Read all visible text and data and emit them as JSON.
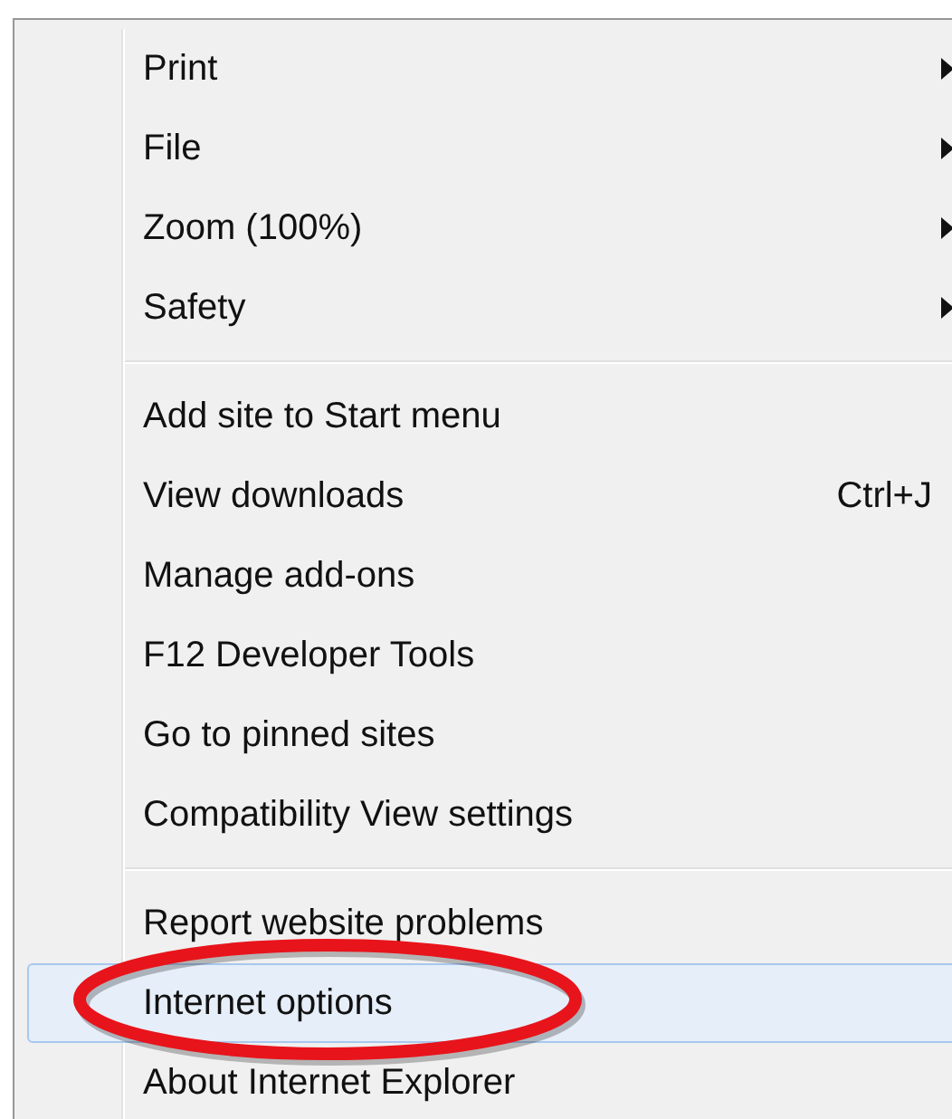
{
  "menu": {
    "groups": [
      {
        "items": [
          {
            "label": "Print",
            "kind": "submenu",
            "selected": false
          },
          {
            "label": "File",
            "kind": "submenu",
            "selected": false
          },
          {
            "label": "Zoom (100%)",
            "kind": "submenu",
            "selected": false
          },
          {
            "label": "Safety",
            "kind": "submenu",
            "selected": false
          }
        ]
      },
      {
        "items": [
          {
            "label": "Add site to Start menu",
            "kind": "plain",
            "selected": false
          },
          {
            "label": "View downloads",
            "kind": "shortcut",
            "shortcut": "Ctrl+J",
            "selected": false
          },
          {
            "label": "Manage add-ons",
            "kind": "plain",
            "selected": false
          },
          {
            "label": "F12 Developer Tools",
            "kind": "plain",
            "selected": false
          },
          {
            "label": "Go to pinned sites",
            "kind": "plain",
            "selected": false
          },
          {
            "label": "Compatibility View settings",
            "kind": "plain",
            "selected": false
          }
        ]
      },
      {
        "items": [
          {
            "label": "Report website problems",
            "kind": "plain",
            "selected": false
          },
          {
            "label": "Internet options",
            "kind": "plain",
            "selected": true
          },
          {
            "label": "About Internet Explorer",
            "kind": "plain",
            "selected": false
          }
        ]
      }
    ]
  }
}
